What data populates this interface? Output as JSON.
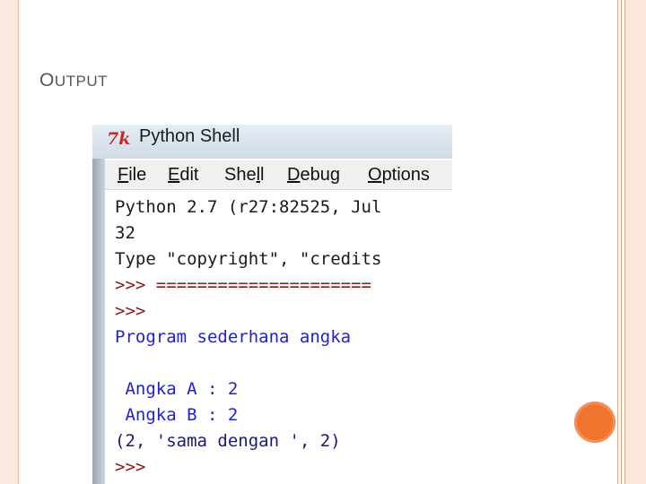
{
  "slide": {
    "title": "Output"
  },
  "window": {
    "title": "Python Shell",
    "icon": "tk-icon",
    "icon_text": "7k"
  },
  "menu": {
    "file": "File",
    "edit": "Edit",
    "shell": "Shell",
    "debug": "Debug",
    "options": "Options"
  },
  "shell_lines": [
    "Python 2.7 (r27:82525, Jul",
    "32",
    "Type \"copyright\", \"credits",
    ">>> =====================",
    ">>>",
    "Program sederhana angka",
    "",
    " Angka A : 2",
    " Angka B : 2",
    "(2, 'sama dengan ', 2)",
    ">>>"
  ],
  "colors": {
    "accent": "#f0752f",
    "frame": "#e8a487",
    "output_blue": "#2222cc",
    "prompt": "#8b1a1a"
  }
}
